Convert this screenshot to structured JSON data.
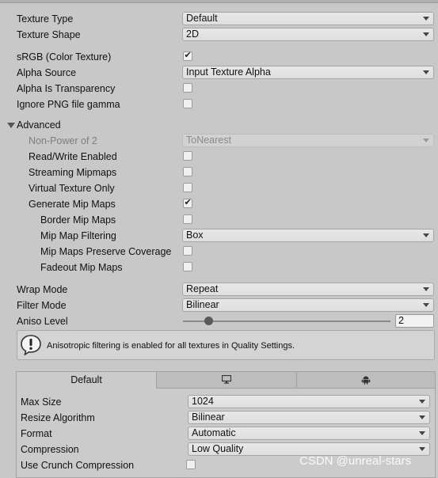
{
  "texture_type": {
    "label": "Texture Type",
    "value": "Default"
  },
  "texture_shape": {
    "label": "Texture Shape",
    "value": "2D"
  },
  "srgb": {
    "label": "sRGB (Color Texture)",
    "checked": true
  },
  "alpha_source": {
    "label": "Alpha Source",
    "value": "Input Texture Alpha"
  },
  "alpha_is_transparency": {
    "label": "Alpha Is Transparency",
    "checked": false
  },
  "ignore_png_gamma": {
    "label": "Ignore PNG file gamma",
    "checked": false
  },
  "advanced": {
    "label": "Advanced",
    "non_power_of_2": {
      "label": "Non-Power of 2",
      "value": "ToNearest"
    },
    "read_write": {
      "label": "Read/Write Enabled",
      "checked": false
    },
    "streaming_mipmaps": {
      "label": "Streaming Mipmaps",
      "checked": false
    },
    "virtual_texture": {
      "label": "Virtual Texture Only",
      "checked": false
    },
    "generate_mip_maps": {
      "label": "Generate Mip Maps",
      "checked": true
    },
    "border_mip_maps": {
      "label": "Border Mip Maps",
      "checked": false
    },
    "mip_map_filtering": {
      "label": "Mip Map Filtering",
      "value": "Box"
    },
    "preserve_coverage": {
      "label": "Mip Maps Preserve Coverage",
      "checked": false
    },
    "fadeout_mip_maps": {
      "label": "Fadeout Mip Maps",
      "checked": false
    }
  },
  "wrap_mode": {
    "label": "Wrap Mode",
    "value": "Repeat"
  },
  "filter_mode": {
    "label": "Filter Mode",
    "value": "Bilinear"
  },
  "aniso_level": {
    "label": "Aniso Level",
    "value": "2",
    "slider_fraction": 0.125
  },
  "help": {
    "text": "Anisotropic filtering is enabled for all textures in Quality Settings.",
    "icon": "info-icon"
  },
  "platform": {
    "tabs": [
      {
        "label": "Default",
        "icon": ""
      },
      {
        "label": "",
        "icon": "monitor-icon"
      },
      {
        "label": "",
        "icon": "android-icon"
      }
    ],
    "max_size": {
      "label": "Max Size",
      "value": "1024"
    },
    "resize_algorithm": {
      "label": "Resize Algorithm",
      "value": "Bilinear"
    },
    "format": {
      "label": "Format",
      "value": "Automatic"
    },
    "compression": {
      "label": "Compression",
      "value": "Low Quality"
    },
    "use_crunch": {
      "label": "Use Crunch Compression",
      "checked": false
    }
  },
  "watermark": "CSDN @unreal-stars",
  "colors": {
    "background": "#c8c8c8",
    "field": "#e4e4e4",
    "disabled_text": "#7e7e7e"
  }
}
